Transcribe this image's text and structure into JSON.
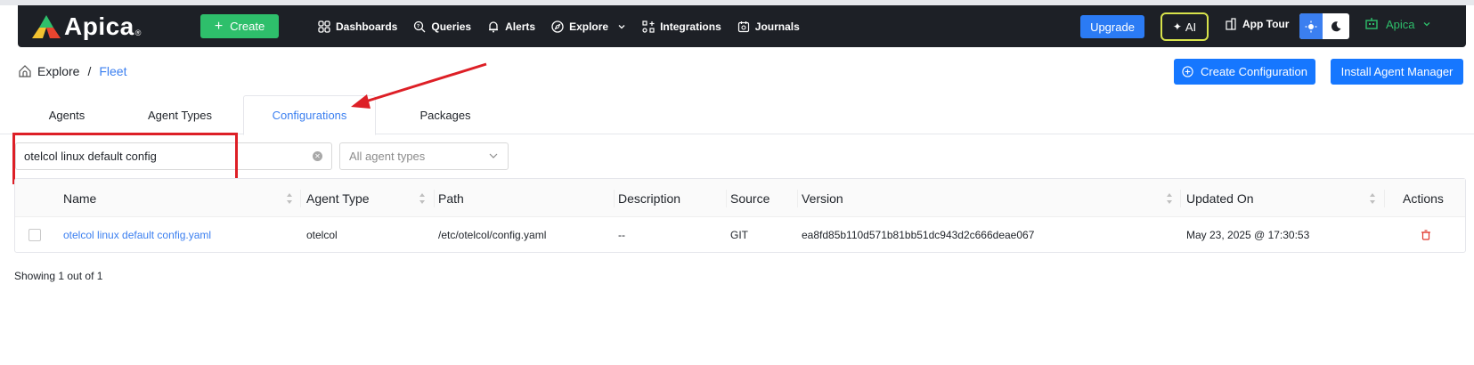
{
  "brand": {
    "name": "Apica"
  },
  "navbar": {
    "create_label": "Create",
    "items": [
      {
        "label": "Dashboards",
        "icon": "grid-icon"
      },
      {
        "label": "Queries",
        "icon": "query-icon"
      },
      {
        "label": "Alerts",
        "icon": "bell-icon"
      },
      {
        "label": "Explore",
        "icon": "compass-icon"
      },
      {
        "label": "Integrations",
        "icon": "integrations-icon"
      },
      {
        "label": "Journals",
        "icon": "journal-icon"
      }
    ],
    "upgrade_label": "Upgrade",
    "ai_label": "AI",
    "app_tour_label": "App Tour",
    "user_label": "Apica"
  },
  "breadcrumb": {
    "root": "Explore",
    "separator": "/",
    "current": "Fleet"
  },
  "actions": {
    "create_config": "Create Configuration",
    "install_agent": "Install Agent Manager"
  },
  "tabs": [
    {
      "label": "Agents",
      "active": false
    },
    {
      "label": "Agent Types",
      "active": false
    },
    {
      "label": "Configurations",
      "active": true
    },
    {
      "label": "Packages",
      "active": false
    }
  ],
  "filters": {
    "search_value": "otelcol linux default config",
    "agent_type_placeholder": "All agent types"
  },
  "table": {
    "columns": [
      "Name",
      "Agent Type",
      "Path",
      "Description",
      "Source",
      "Version",
      "Updated On",
      "Actions"
    ],
    "rows": [
      {
        "name": "otelcol linux default config.yaml",
        "agent_type": "otelcol",
        "path": "/etc/otelcol/config.yaml",
        "description": "--",
        "source": "GIT",
        "version": "ea8fd85b110d571b81bb51dc943d2c666deae067",
        "updated_on": "May 23, 2025 @ 17:30:53"
      }
    ]
  },
  "footer": {
    "showing": "Showing 1 out of 1"
  },
  "colors": {
    "accent": "#1677ff",
    "create_green": "#2ebf6b",
    "annotation_red": "#dd1f26",
    "navbar": "#1d2026"
  }
}
